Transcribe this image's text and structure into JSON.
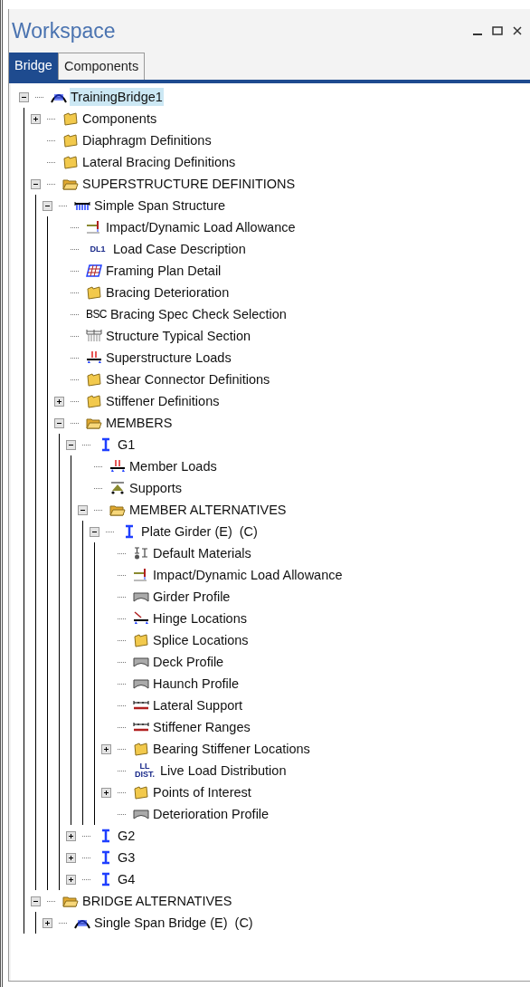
{
  "window": {
    "title": "Workspace"
  },
  "tabs": [
    {
      "label": "Bridge",
      "selected": true
    },
    {
      "label": "Components",
      "selected": false
    }
  ],
  "tree": [
    {
      "label": "TrainingBridge1",
      "kind": "bridge",
      "selected": true,
      "expanded": true,
      "children": [
        {
          "label": "Components",
          "kind": "folder",
          "selected": false,
          "expanded": false
        },
        {
          "label": "Diaphragm Definitions",
          "kind": "folder",
          "selected": false
        },
        {
          "label": "Lateral Bracing Definitions",
          "kind": "folder",
          "selected": false
        },
        {
          "label": "SUPERSTRUCTURE DEFINITIONS",
          "kind": "folder_open",
          "selected": false,
          "expanded": true,
          "children": [
            {
              "label": "Simple Span Structure",
              "kind": "span",
              "selected": false,
              "expanded": true,
              "children": [
                {
                  "label": "Impact/Dynamic Load Allowance",
                  "kind": "impact",
                  "selected": false
                },
                {
                  "label": "Load Case Description",
                  "kind": "load_case",
                  "icon_text": "DL1",
                  "selected": false
                },
                {
                  "label": "Framing Plan Detail",
                  "kind": "framing",
                  "selected": false
                },
                {
                  "label": "Bracing Deterioration",
                  "kind": "folder",
                  "selected": false
                },
                {
                  "label": "Bracing Spec Check Selection",
                  "kind": "text",
                  "icon_text": "BSC",
                  "selected": false
                },
                {
                  "label": "Structure Typical Section",
                  "kind": "typical_section",
                  "selected": false
                },
                {
                  "label": "Superstructure Loads",
                  "kind": "loads",
                  "selected": false
                },
                {
                  "label": "Shear Connector Definitions",
                  "kind": "folder",
                  "selected": false
                },
                {
                  "label": "Stiffener Definitions",
                  "kind": "folder",
                  "selected": false,
                  "expanded": false
                },
                {
                  "label": "MEMBERS",
                  "kind": "folder_open",
                  "selected": false,
                  "expanded": true,
                  "children": [
                    {
                      "label": "G1",
                      "kind": "girder",
                      "selected": false,
                      "expanded": true,
                      "children": [
                        {
                          "label": "Member Loads",
                          "kind": "loads",
                          "selected": false
                        },
                        {
                          "label": "Supports",
                          "kind": "supports",
                          "selected": false
                        },
                        {
                          "label": "MEMBER ALTERNATIVES",
                          "kind": "folder_open",
                          "selected": false,
                          "expanded": true,
                          "children": [
                            {
                              "label": "Plate Girder (E)  (C)",
                              "kind": "girder",
                              "selected": false,
                              "expanded": true,
                              "children": [
                                {
                                  "label": "Default Materials",
                                  "kind": "materials",
                                  "selected": false
                                },
                                {
                                  "label": "Impact/Dynamic Load Allowance",
                                  "kind": "impact",
                                  "selected": false
                                },
                                {
                                  "label": "Girder Profile",
                                  "kind": "profile",
                                  "selected": false
                                },
                                {
                                  "label": "Hinge Locations",
                                  "kind": "hinge",
                                  "selected": false
                                },
                                {
                                  "label": "Splice Locations",
                                  "kind": "folder",
                                  "selected": false
                                },
                                {
                                  "label": "Deck Profile",
                                  "kind": "profile",
                                  "selected": false
                                },
                                {
                                  "label": "Haunch Profile",
                                  "kind": "profile",
                                  "selected": false
                                },
                                {
                                  "label": "Lateral Support",
                                  "kind": "lateral",
                                  "selected": false
                                },
                                {
                                  "label": "Stiffener Ranges",
                                  "kind": "lateral",
                                  "selected": false
                                },
                                {
                                  "label": "Bearing Stiffener Locations",
                                  "kind": "folder",
                                  "selected": false,
                                  "expanded": false
                                },
                                {
                                  "label": "Live Load Distribution",
                                  "kind": "load_case",
                                  "icon_text": "LL DIST.",
                                  "selected": false
                                },
                                {
                                  "label": "Points of Interest",
                                  "kind": "folder",
                                  "selected": false,
                                  "expanded": false
                                },
                                {
                                  "label": "Deterioration Profile",
                                  "kind": "profile",
                                  "selected": false
                                }
                              ]
                            }
                          ]
                        }
                      ]
                    },
                    {
                      "label": "G2",
                      "kind": "girder",
                      "selected": false,
                      "expanded": false
                    },
                    {
                      "label": "G3",
                      "kind": "girder",
                      "selected": false,
                      "expanded": false
                    },
                    {
                      "label": "G4",
                      "kind": "girder",
                      "selected": false,
                      "expanded": false
                    }
                  ]
                }
              ]
            }
          ]
        },
        {
          "label": "BRIDGE ALTERNATIVES",
          "kind": "folder_open",
          "selected": false,
          "expanded": true,
          "children": [
            {
              "label": "Single Span Bridge (E)  (C)",
              "kind": "bridge",
              "selected": false,
              "expanded": false
            }
          ]
        }
      ]
    }
  ]
}
